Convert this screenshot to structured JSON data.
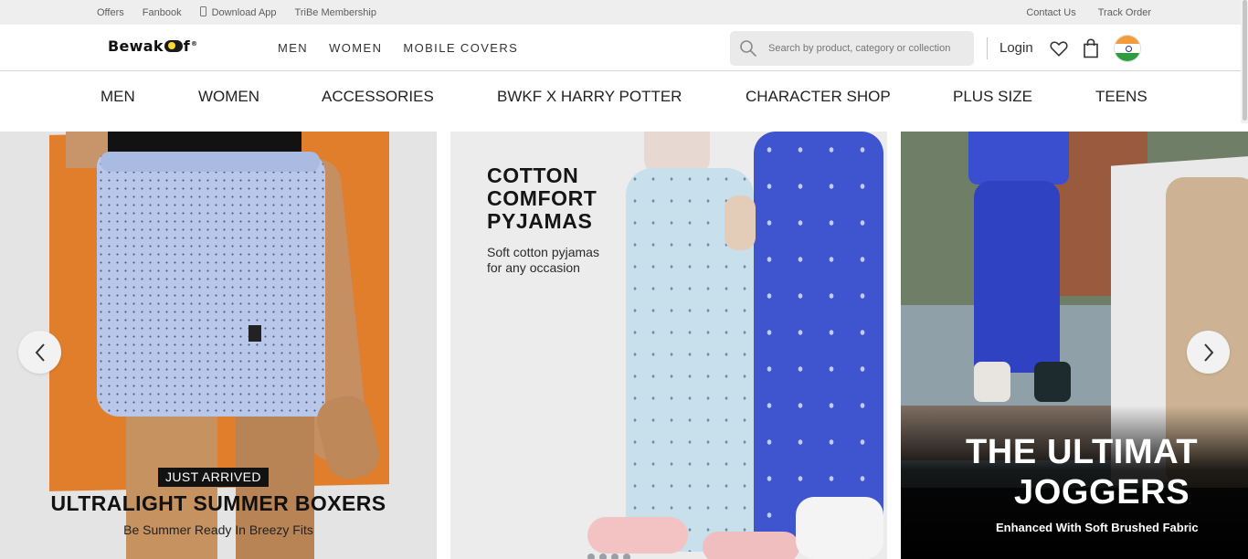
{
  "topbar": {
    "left_links": [
      "Offers",
      "Fanbook",
      "Download App",
      "TriBe Membership"
    ],
    "right_links": [
      "Contact Us",
      "Track Order"
    ]
  },
  "header": {
    "logo_pre": "Bewak",
    "logo_post": "f",
    "logo_mark": "®",
    "nav": [
      "MEN",
      "WOMEN",
      "MOBILE COVERS"
    ],
    "search_placeholder": "Search by product, category or collection",
    "login_label": "Login",
    "icons": [
      "search-icon",
      "heart-icon",
      "bag-icon",
      "india-flag-icon"
    ]
  },
  "category_nav": [
    "MEN",
    "WOMEN",
    "ACCESSORIES",
    "BWKF X HARRY POTTER",
    "CHARACTER SHOP",
    "PLUS SIZE",
    "TEENS"
  ],
  "banners": [
    {
      "badge": "JUST ARRIVED",
      "title": "ULTRALIGHT SUMMER BOXERS",
      "subtitle": "Be Summer Ready In Breezy Fits"
    },
    {
      "title_lines": [
        "COTTON",
        "COMFORT",
        "PYJAMAS"
      ],
      "subtitle_lines": [
        "Soft cotton pyjamas",
        "for any occasion"
      ]
    },
    {
      "title_lines": [
        "THE ULTIMAT",
        "JOGGERS"
      ],
      "subtitle": "Enhanced With Soft Brushed Fabric"
    }
  ],
  "carousel": {
    "prev_icon": "chevron-left-icon",
    "next_icon": "chevron-right-icon"
  },
  "colors": {
    "orange_backdrop": "#e07e2c",
    "pyjama_blue": "#3f54cf",
    "jogger_blue": "#2f42c2"
  }
}
